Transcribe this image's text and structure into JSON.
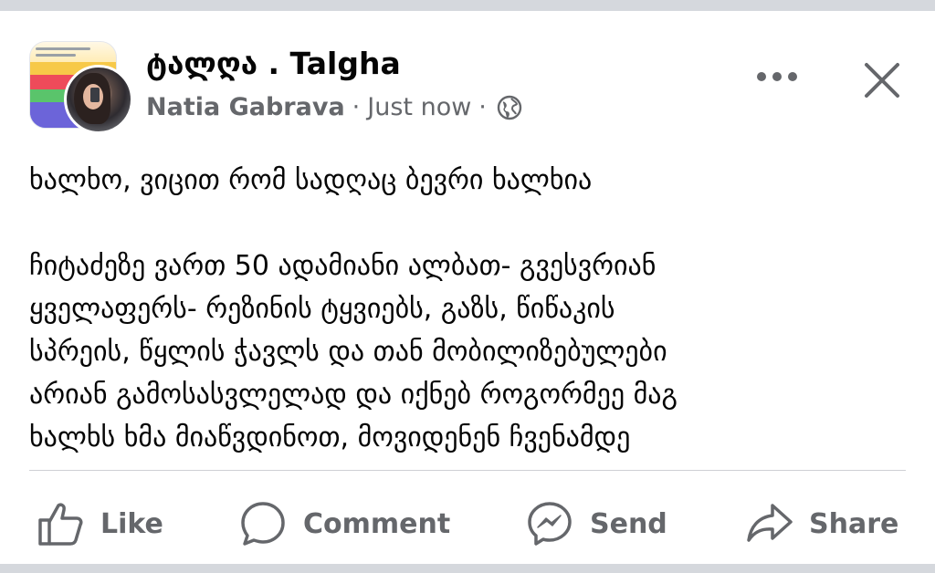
{
  "post": {
    "group_name": "ტალღა . Talgha",
    "author": "Natia Gabrava",
    "separator": "·",
    "timestamp": "Just now",
    "lines": [
      "ხალხო, ვიცით რომ სადღაც ბევრი ხალხია",
      "ჩიტაძეზე ვართ 50 ადამიანი ალბათ- გვესვრიან",
      "ყველაფერს- რეზინის ტყვიებს, გაზს, წიწაკის",
      "სპრეის, წყლის ჭავლს და თან მობილიზებულები",
      "არიან გამოსასვლელად და იქნებ როგორმეე მაგ",
      "ხალხს ხმა მიაწვდინოთ, მოვიდენენ ჩვენამდე"
    ]
  },
  "header": {
    "more_icon": "more-horizontal-icon",
    "close_icon": "close-icon",
    "privacy_icon": "globe-icon"
  },
  "actions": {
    "like": "Like",
    "comment": "Comment",
    "send": "Send",
    "share": "Share"
  },
  "colors": {
    "text_primary": "#050505",
    "text_secondary": "#65676b",
    "divider": "#ced0d4",
    "background_strip": "#d5d8dd"
  }
}
